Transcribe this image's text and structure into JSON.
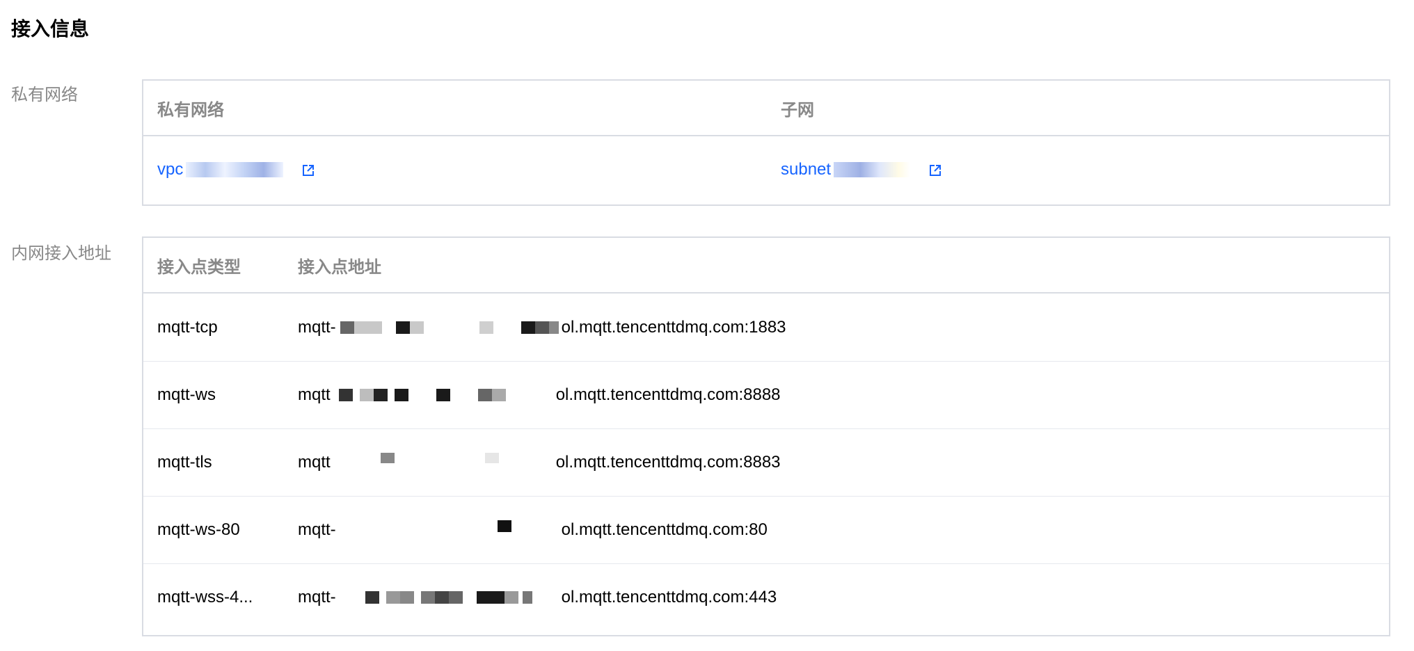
{
  "section_title": "接入信息",
  "vpc_section": {
    "label": "私有网络",
    "headers": [
      "私有网络",
      "子网"
    ],
    "vpc_link_text": "vpc",
    "subnet_link_text": "subnet"
  },
  "endpoint_section": {
    "label": "内网接入地址",
    "headers": [
      "接入点类型",
      "接入点地址"
    ],
    "rows": [
      {
        "type": "mqtt-tcp",
        "prefix": "mqtt-",
        "suffix": "ol.mqtt.tencenttdmq.com:1883"
      },
      {
        "type": "mqtt-ws",
        "prefix": "mqtt",
        "suffix": "ol.mqtt.tencenttdmq.com:8888"
      },
      {
        "type": "mqtt-tls",
        "prefix": "mqtt",
        "suffix": "ol.mqtt.tencenttdmq.com:8883"
      },
      {
        "type": "mqtt-ws-80",
        "prefix": "mqtt-",
        "suffix": "ol.mqtt.tencenttdmq.com:80"
      },
      {
        "type": "mqtt-wss-4...",
        "prefix": "mqtt-",
        "suffix": "ol.mqtt.tencenttdmq.com:443"
      }
    ]
  },
  "colors": {
    "link": "#1664ff",
    "label": "#888888",
    "border": "#d9dce3"
  }
}
